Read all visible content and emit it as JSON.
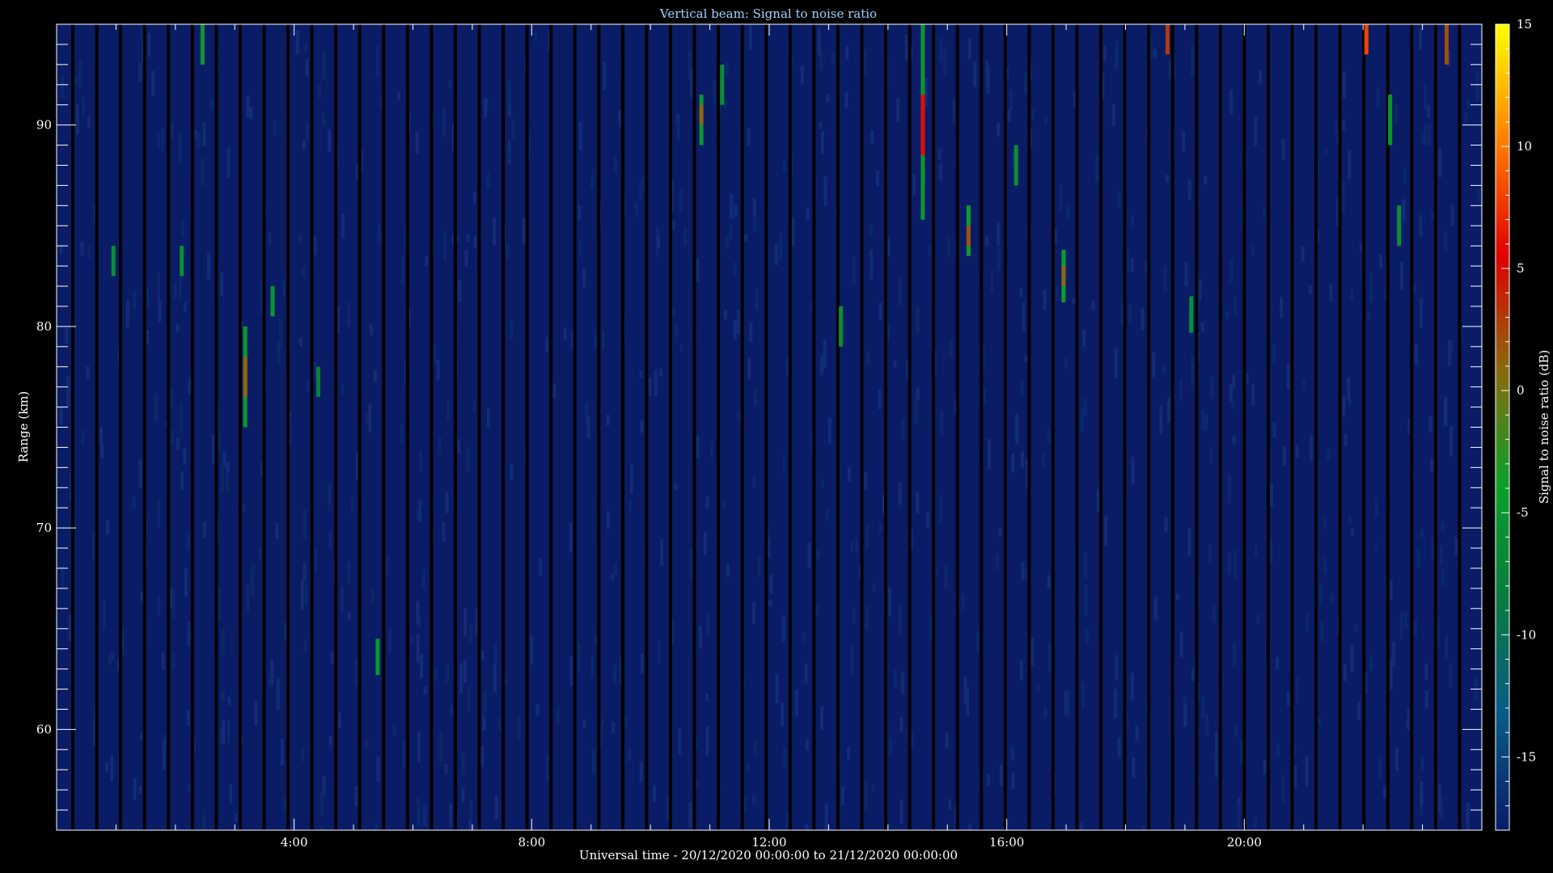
{
  "chart_data": {
    "type": "heatmap",
    "title": "Vertical beam: Signal to noise ratio",
    "xlabel": "Universal time - 20/12/2020 00:00:00 to 21/12/2020 00:00:00",
    "ylabel": "Range (km)",
    "colorbar_label": "Signal to noise ratio (dB)",
    "x_range_hours": [
      0,
      24
    ],
    "y_range_km": [
      55,
      95
    ],
    "colorbar_range_db": [
      -18,
      15
    ],
    "x_ticks": [
      {
        "value": 4,
        "label": "4:00"
      },
      {
        "value": 8,
        "label": "8:00"
      },
      {
        "value": 12,
        "label": "12:00"
      },
      {
        "value": 16,
        "label": "16:00"
      },
      {
        "value": 20,
        "label": "20:00"
      }
    ],
    "y_ticks": [
      {
        "value": 60,
        "label": "60"
      },
      {
        "value": 70,
        "label": "70"
      },
      {
        "value": 80,
        "label": "80"
      },
      {
        "value": 90,
        "label": "90"
      }
    ],
    "colorbar_ticks": [
      {
        "value": 15,
        "label": "15"
      },
      {
        "value": 10,
        "label": "10"
      },
      {
        "value": 5,
        "label": "5"
      },
      {
        "value": 0,
        "label": "0"
      },
      {
        "value": -5,
        "label": "-5"
      },
      {
        "value": -10,
        "label": "-10"
      },
      {
        "value": -15,
        "label": "-15"
      }
    ],
    "background_snr_db": -16,
    "events": [
      {
        "t": 0.95,
        "r0": 82.5,
        "r1": 84.0,
        "snr": -6
      },
      {
        "t": 2.1,
        "r0": 82.5,
        "r1": 84.0,
        "snr": -6
      },
      {
        "t": 2.45,
        "r0": 93.0,
        "r1": 95.0,
        "snr": -5
      },
      {
        "t": 3.17,
        "r0": 75.0,
        "r1": 80.0,
        "snr": -5
      },
      {
        "t": 3.17,
        "r0": 76.5,
        "r1": 78.5,
        "snr": 1
      },
      {
        "t": 3.63,
        "r0": 80.5,
        "r1": 82.0,
        "snr": -5
      },
      {
        "t": 4.4,
        "r0": 76.5,
        "r1": 78.0,
        "snr": -8
      },
      {
        "t": 5.4,
        "r0": 62.7,
        "r1": 64.5,
        "snr": -5
      },
      {
        "t": 10.85,
        "r0": 89.0,
        "r1": 91.5,
        "snr": -5
      },
      {
        "t": 10.85,
        "r0": 90.0,
        "r1": 91.0,
        "snr": 1
      },
      {
        "t": 11.2,
        "r0": 91.0,
        "r1": 93.0,
        "snr": -6
      },
      {
        "t": 13.2,
        "r0": 79.0,
        "r1": 81.0,
        "snr": -6
      },
      {
        "t": 14.58,
        "r0": 85.3,
        "r1": 95.0,
        "snr": -5
      },
      {
        "t": 14.58,
        "r0": 88.5,
        "r1": 91.5,
        "snr": 6
      },
      {
        "t": 15.35,
        "r0": 83.5,
        "r1": 86.0,
        "snr": -4
      },
      {
        "t": 15.35,
        "r0": 84.0,
        "r1": 85.0,
        "snr": 2
      },
      {
        "t": 16.15,
        "r0": 87.0,
        "r1": 89.0,
        "snr": -6
      },
      {
        "t": 16.95,
        "r0": 81.2,
        "r1": 83.8,
        "snr": -4
      },
      {
        "t": 16.95,
        "r0": 82.0,
        "r1": 83.0,
        "snr": 1
      },
      {
        "t": 18.7,
        "r0": 93.5,
        "r1": 95.0,
        "snr": 3
      },
      {
        "t": 19.1,
        "r0": 79.7,
        "r1": 81.5,
        "snr": -6
      },
      {
        "t": 22.05,
        "r0": 93.5,
        "r1": 95.0,
        "snr": 8
      },
      {
        "t": 22.45,
        "r0": 89.0,
        "r1": 91.5,
        "snr": -5
      },
      {
        "t": 22.6,
        "r0": 84.0,
        "r1": 86.0,
        "snr": -6
      },
      {
        "t": 23.4,
        "r0": 93.0,
        "r1": 95.0,
        "snr": 2
      }
    ]
  },
  "colors": {
    "background": "#000000",
    "noise_floor": "#0a1c66",
    "frame": "#ffffff",
    "title": "#9fd4ff",
    "colorbar_stops": [
      "#0a1c66",
      "#0a5a88",
      "#0a7a40",
      "#0aa02a",
      "#8a6a10",
      "#e00000",
      "#ff8000",
      "#ffff00"
    ]
  }
}
